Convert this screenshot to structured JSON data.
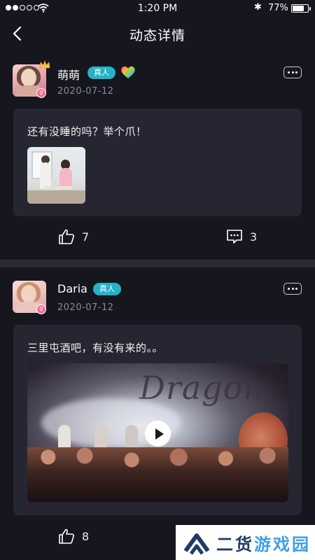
{
  "status_bar": {
    "time": "1:20 PM",
    "battery_percent": "77%",
    "battery_level": 0.77,
    "signal_bars_filled": 2,
    "signal_bars_total": 5
  },
  "nav": {
    "title": "动态详情",
    "back_icon": "chevron-left-icon"
  },
  "posts": [
    {
      "username": "萌萌",
      "badge": "真人",
      "date": "2020-07-12",
      "text": "还有没睡的吗？举个爪！",
      "media": "photo",
      "likes": "7",
      "comments": "3",
      "has_crown": true,
      "has_rainbow_heart": true
    },
    {
      "username": "Daria",
      "badge": "真人",
      "date": "2020-07-12",
      "text": "三里屯酒吧，有没有来的。。",
      "media": "video",
      "likes": "8"
    }
  ],
  "watermark": {
    "text_part1": "二货",
    "text_part2": "游戏园"
  },
  "colors": {
    "background": "#16161f",
    "card": "#262632",
    "badge": "#27b3c7",
    "gender": "#ef6f95",
    "date": "#8a8a99"
  }
}
